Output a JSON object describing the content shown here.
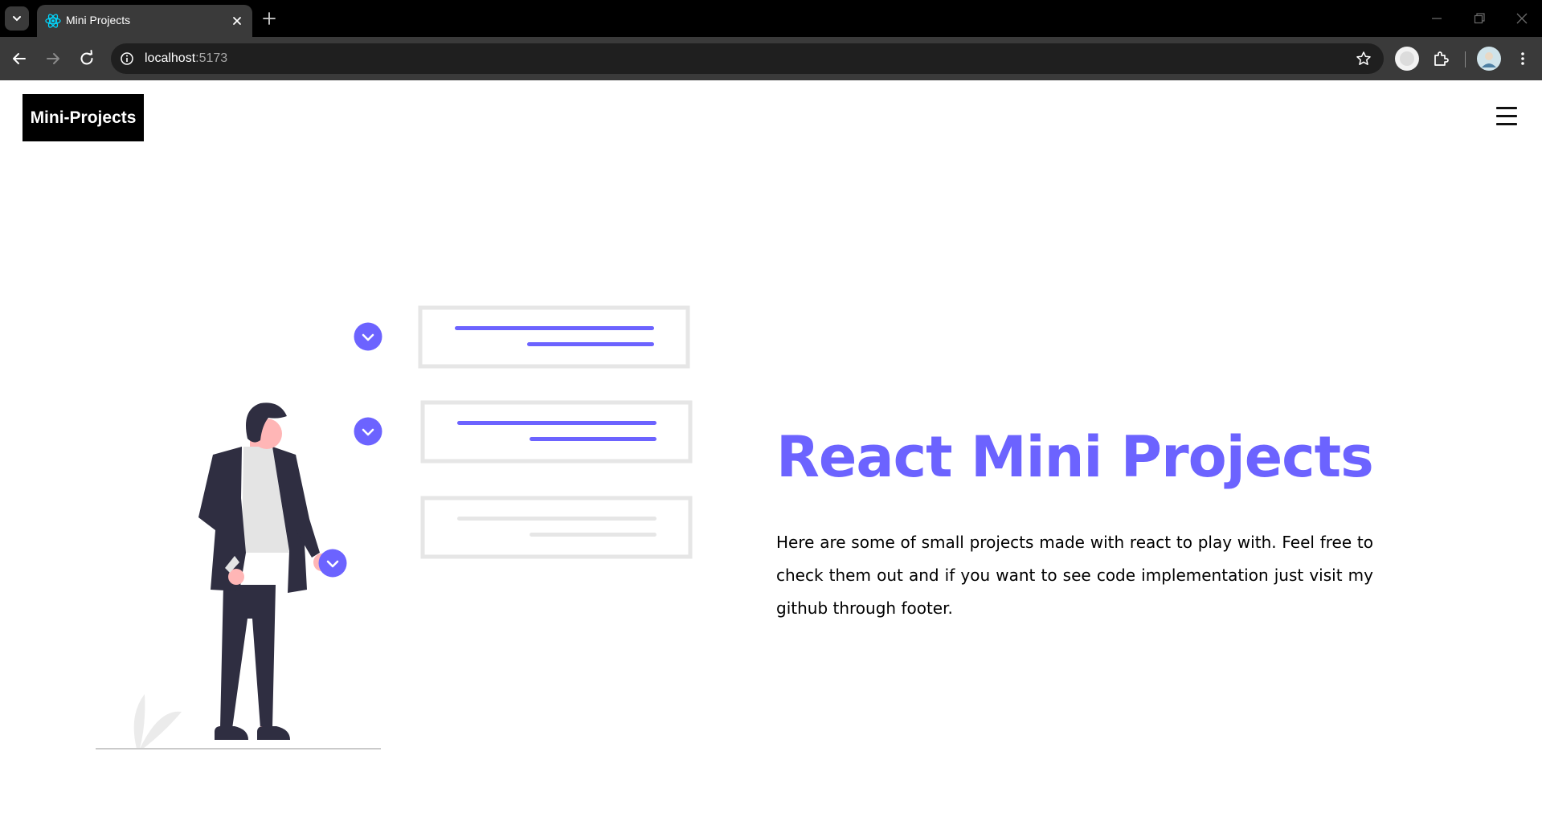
{
  "browser": {
    "tab_title": "Mini Projects",
    "url_host": "localhost",
    "url_port": ":5173"
  },
  "navbar": {
    "brand": "Mini-Projects"
  },
  "hero": {
    "title": "React Mini Projects",
    "description": "Here are some of small projects made with react to play with. Feel free to check them out and if you want to see code implementation just visit my github through footer."
  },
  "colors": {
    "accent": "#6c63ff",
    "figure_dark": "#2f2e41",
    "skin": "#ffb6b6",
    "placeholder_gray": "#e6e6e6"
  },
  "icons": {
    "menu": "hamburger-menu-icon",
    "favicon": "react-atom-icon"
  }
}
